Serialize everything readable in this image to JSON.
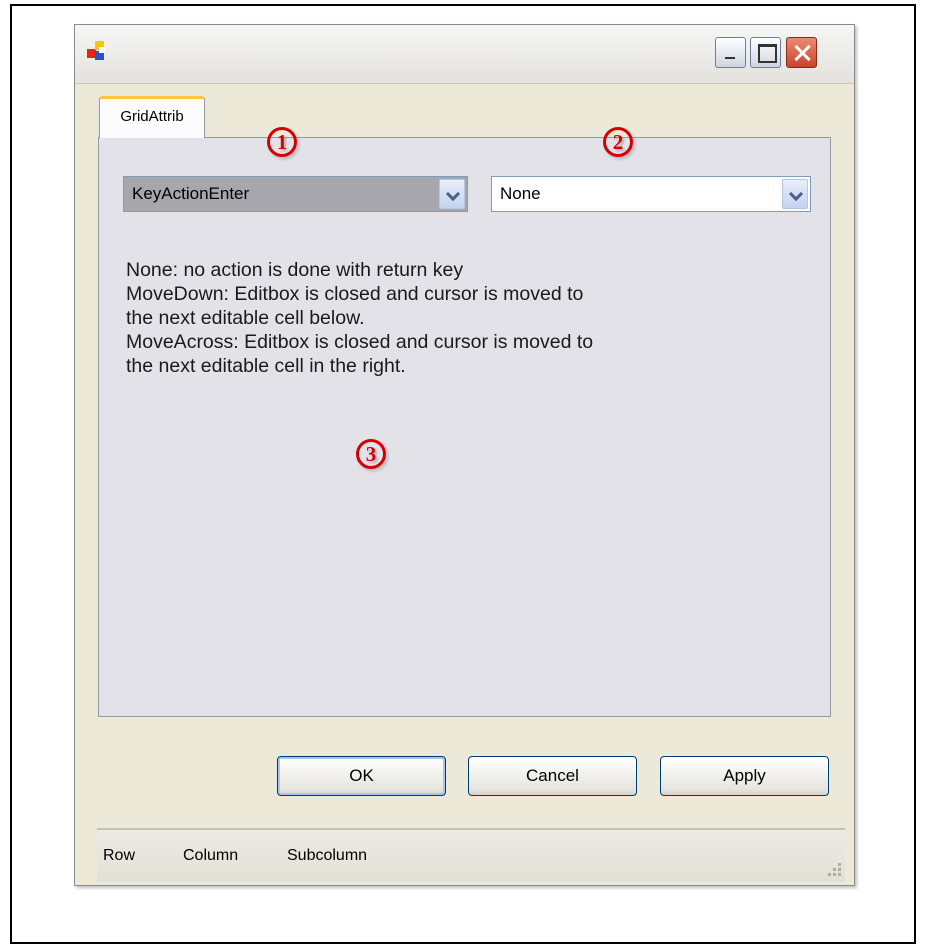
{
  "tabs": [
    {
      "label": "GridAttrib"
    }
  ],
  "combo_setting": {
    "value": "KeyActionEnter"
  },
  "combo_value": {
    "value": "None"
  },
  "description": [
    "None: no action is done with return key",
    "MoveDown:  Editbox is closed and cursor is moved to",
    "the next editable cell below.",
    "MoveAcross: Editbox is closed and cursor is moved to",
    "the next editable cell in the right."
  ],
  "markers": [
    "1",
    "2",
    "3"
  ],
  "buttons": {
    "ok": "OK",
    "cancel": "Cancel",
    "apply": "Apply"
  },
  "statusbar": {
    "row": "Row",
    "column": "Column",
    "subcolumn": "Subcolumn"
  },
  "colors": {
    "window_bg": "#ECE9D8",
    "marker": "#D40000",
    "tab_accent": "#FFC83C"
  }
}
